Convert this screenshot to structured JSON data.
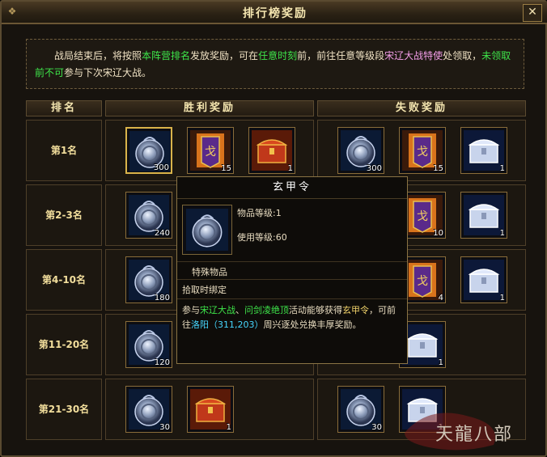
{
  "window": {
    "title": "排行榜奖励",
    "close_label": "✕"
  },
  "notice": {
    "parts": [
      {
        "text": "战局结束后，将按照",
        "color": "normal"
      },
      {
        "text": "本阵营排名",
        "color": "green"
      },
      {
        "text": "发放奖励，可在",
        "color": "normal"
      },
      {
        "text": "任意时刻",
        "color": "green"
      },
      {
        "text": "前，前往任意等级段",
        "color": "normal"
      },
      {
        "text": "宋辽大战特使",
        "color": "pink"
      },
      {
        "text": "处领取，",
        "color": "normal"
      },
      {
        "text": "未领取前不可",
        "color": "green"
      },
      {
        "text": "参与下次宋辽大战。",
        "color": "normal"
      }
    ]
  },
  "table": {
    "headers": {
      "rank": "排名",
      "win": "胜利奖励",
      "lose": "失败奖励"
    },
    "rows": [
      {
        "rank": "第1名",
        "win": [
          {
            "icon": "medal-icon",
            "qty": "300"
          },
          {
            "icon": "banner-token-icon",
            "qty": "15"
          },
          {
            "icon": "red-chest-icon",
            "qty": "1"
          }
        ],
        "lose": [
          {
            "icon": "medal-icon",
            "qty": "300"
          },
          {
            "icon": "banner-token-icon",
            "qty": "15"
          },
          {
            "icon": "silver-chest-icon",
            "qty": "1"
          }
        ]
      },
      {
        "rank": "第2-3名",
        "win": [
          {
            "icon": "medal-icon",
            "qty": "240"
          }
        ],
        "lose": [
          {
            "icon": "banner-token-icon",
            "qty": "10"
          },
          {
            "icon": "silver-chest-icon",
            "qty": "1"
          }
        ]
      },
      {
        "rank": "第4-10名",
        "win": [
          {
            "icon": "medal-icon",
            "qty": "180"
          }
        ],
        "lose": [
          {
            "icon": "banner-token-icon",
            "qty": "4"
          },
          {
            "icon": "silver-chest-icon",
            "qty": "1"
          }
        ]
      },
      {
        "rank": "第11-20名",
        "win": [
          {
            "icon": "medal-icon",
            "qty": "120"
          }
        ],
        "lose": [
          {
            "icon": "silver-chest-icon",
            "qty": "1"
          }
        ]
      },
      {
        "rank": "第21-30名",
        "win": [
          {
            "icon": "medal-icon",
            "qty": "30"
          },
          {
            "icon": "red-chest-icon",
            "qty": "1"
          }
        ],
        "lose": [
          {
            "icon": "medal-icon",
            "qty": "30"
          },
          {
            "icon": "silver-chest-icon",
            "qty": "1"
          }
        ]
      }
    ]
  },
  "tooltip": {
    "title": "玄甲令",
    "item_level": "物品等级:1",
    "use_level": "使用等级:60",
    "category": "特殊物品",
    "binding": "拾取时绑定",
    "desc_parts": [
      {
        "text": "参与",
        "color": "normal"
      },
      {
        "text": "宋辽大战",
        "color": "green"
      },
      {
        "text": "、",
        "color": "normal"
      },
      {
        "text": "问剑凌绝顶",
        "color": "green"
      },
      {
        "text": "活动能够获得",
        "color": "normal"
      },
      {
        "text": "玄甲令",
        "color": "yellow"
      },
      {
        "text": "，可前往",
        "color": "normal"
      },
      {
        "text": "洛阳（311,203）",
        "color": "cyan"
      },
      {
        "text": "周兴逐处兑换丰厚奖励。",
        "color": "normal"
      }
    ]
  },
  "watermark": {
    "text": "天龍八部"
  },
  "colors": {
    "green": "#3ee54a",
    "pink": "#f39ee8",
    "yellow": "#f0d26a",
    "cyan": "#46d7ff",
    "gold": "#d9b34a"
  }
}
